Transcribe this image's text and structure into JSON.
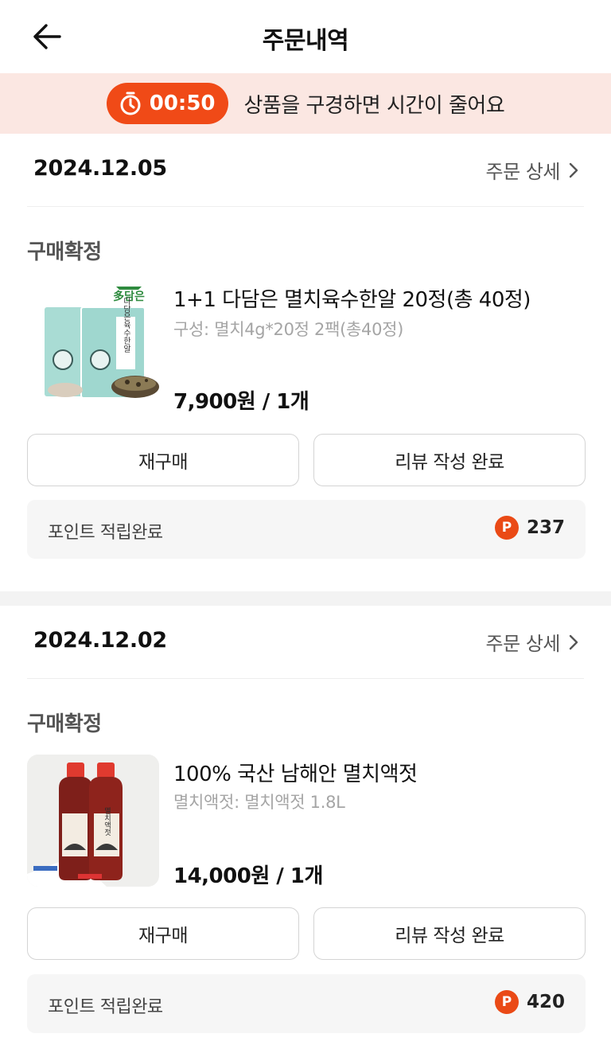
{
  "header": {
    "title": "주문내역"
  },
  "timer": {
    "time": "00:50",
    "message": "상품을 구경하면 시간이 줄어요"
  },
  "orders": [
    {
      "date": "2024.12.05",
      "detail_label": "주문 상세",
      "status": "구매확정",
      "product": {
        "name": "1+1 다담은 멸치육수한알 20정(총 40정)",
        "option": "구성: 멸치4g*20정 2팩(총40정)",
        "price": "7,900원 / 1개",
        "thumb_brand": "多담은",
        "thumb_label": "다담은육수한알"
      },
      "rebuy_label": "재구매",
      "review_label": "리뷰 작성 완료",
      "points": {
        "label": "포인트 적립완료",
        "badge": "P",
        "value": "237"
      }
    },
    {
      "date": "2024.12.02",
      "detail_label": "주문 상세",
      "status": "구매확정",
      "product": {
        "name": "100% 국산 남해안 멸치액젓",
        "option": "멸치액젓: 멸치액젓 1.8L",
        "price": "14,000원 / 1개",
        "thumb_label": "멸치액젓"
      },
      "rebuy_label": "재구매",
      "review_label": "리뷰 작성 완료",
      "points": {
        "label": "포인트 적립완료",
        "badge": "P",
        "value": "420"
      }
    }
  ],
  "colors": {
    "accent": "#f04a17",
    "banner_bg": "#fbe7e2",
    "point_bg": "#f6f6f6"
  },
  "icons": {
    "back": "arrow-left-icon",
    "timer": "stopwatch-icon",
    "chevron": "chevron-right-icon",
    "point": "point-badge-icon"
  }
}
